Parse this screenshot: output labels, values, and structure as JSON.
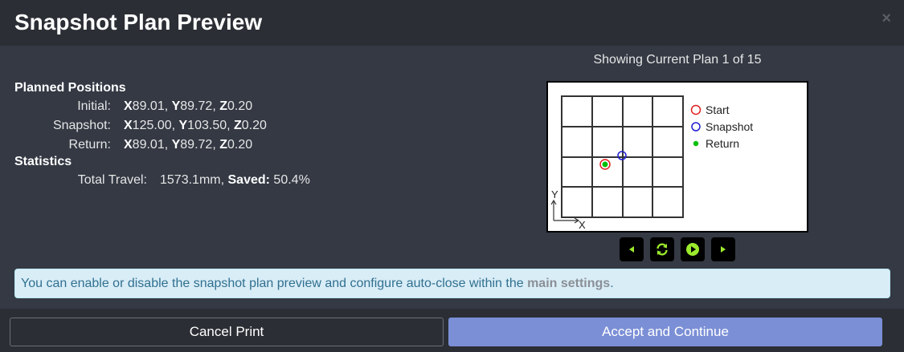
{
  "dialog": {
    "title": "Snapshot Plan Preview",
    "close_glyph": "×"
  },
  "planned_positions": {
    "heading": "Planned Positions",
    "rows": [
      {
        "label": "Initial:",
        "x_key": "X",
        "x": "89.01",
        "y_key": "Y",
        "y": "89.72",
        "z_key": "Z",
        "z": "0.20"
      },
      {
        "label": "Snapshot:",
        "x_key": "X",
        "x": "125.00",
        "y_key": "Y",
        "y": "103.50",
        "z_key": "Z",
        "z": "0.20"
      },
      {
        "label": "Return:",
        "x_key": "X",
        "x": "89.01",
        "y_key": "Y",
        "y": "89.72",
        "z_key": "Z",
        "z": "0.20"
      }
    ]
  },
  "statistics": {
    "heading": "Statistics",
    "total_travel_label": "Total Travel:",
    "total_travel_value": "1573.1mm,",
    "saved_label": "Saved:",
    "saved_value": "50.4%"
  },
  "plan_caption": "Showing Current Plan 1 of 15",
  "preview": {
    "legend": [
      {
        "label": "Start",
        "color": "#e02020"
      },
      {
        "label": "Snapshot",
        "color": "#2020d0"
      },
      {
        "label": "Return",
        "color": "#00c000"
      }
    ],
    "axis_y_label": "Y",
    "axis_x_label": "X"
  },
  "controls": [
    {
      "name": "previous-plan-button",
      "icon": "caret-left-icon"
    },
    {
      "name": "refresh-plan-button",
      "icon": "refresh-icon"
    },
    {
      "name": "play-plan-button",
      "icon": "play-circle-icon"
    },
    {
      "name": "next-plan-button",
      "icon": "caret-right-icon"
    }
  ],
  "info": {
    "text": "You can enable or disable the snapshot plan preview and configure auto-close within the ",
    "link": "main settings",
    "suffix": "."
  },
  "footer": {
    "cancel_label": "Cancel Print",
    "accept_label": "Accept and Continue"
  },
  "colors": {
    "accent_button": "#7b8fd6",
    "control_icon": "#9bea2d"
  }
}
